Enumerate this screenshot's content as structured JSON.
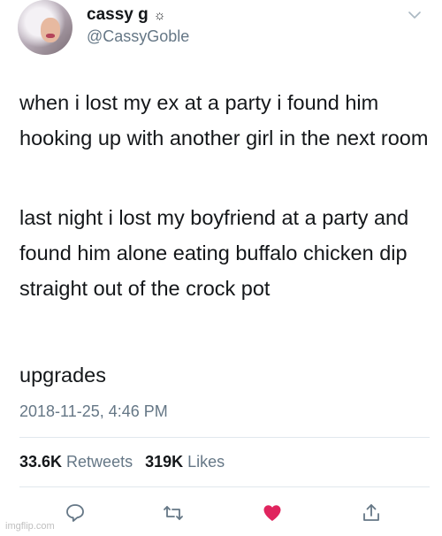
{
  "tweet": {
    "display_name": "cassy g",
    "name_emoji": "☼",
    "handle": "@CassyGoble",
    "paragraphs": [
      "when i lost my ex at a party i found him hooking up with another girl in the next room",
      "last night i lost my boyfriend at a party and found him alone eating buffalo chicken dip straight out of the crock pot",
      "upgrades"
    ],
    "timestamp": "2018-11-25, 4:46 PM",
    "stats": {
      "retweets_count": "33.6K",
      "retweets_label": "Retweets",
      "likes_count": "319K",
      "likes_label": "Likes"
    },
    "liked": true
  },
  "icons": {
    "caret": "chevron-down-icon",
    "reply": "reply-icon",
    "retweet": "retweet-icon",
    "like": "heart-icon",
    "share": "share-icon"
  },
  "colors": {
    "like_active": "#e0245e",
    "secondary_text": "#657786",
    "icon": "#657786"
  },
  "watermark": "imgflip.com"
}
